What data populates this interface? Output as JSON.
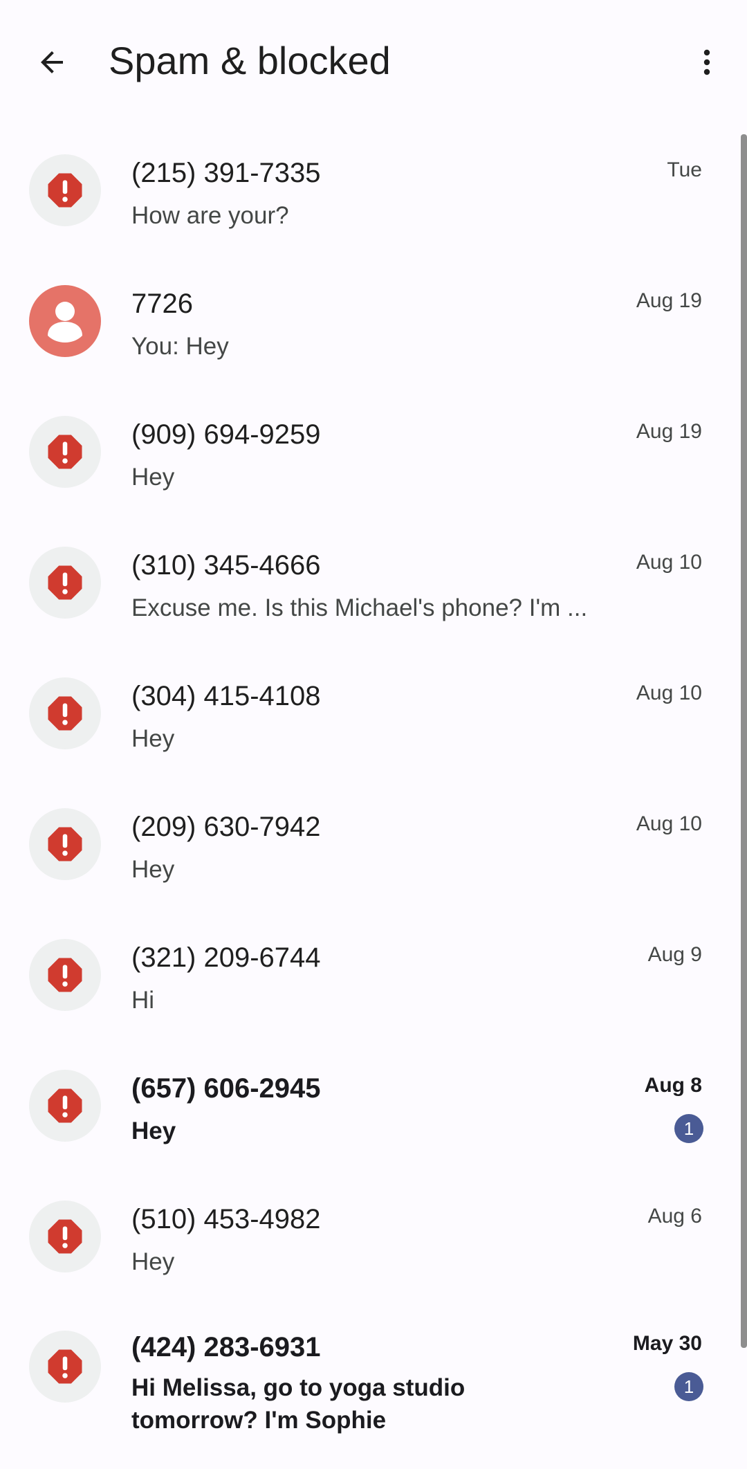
{
  "header": {
    "title": "Spam & blocked",
    "back_icon": "arrow-back-icon",
    "more_icon": "more-vert-icon"
  },
  "colors": {
    "background": "#FDFBFF",
    "spam_icon": "#D03B2F",
    "contact_avatar": "#E57368",
    "unread_badge": "#4A5B95"
  },
  "conversations": [
    {
      "name": "(215) 391-7335",
      "snippet": "How are your?",
      "date": "Tue",
      "unread": false,
      "avatar": "spam-warning-icon"
    },
    {
      "name": "7726",
      "snippet": "You: Hey",
      "date": "Aug 19",
      "unread": false,
      "avatar": "person-icon"
    },
    {
      "name": "(909) 694-9259",
      "snippet": "Hey",
      "date": "Aug 19",
      "unread": false,
      "avatar": "spam-warning-icon"
    },
    {
      "name": "(310) 345-4666",
      "snippet": "Excuse me. Is this Michael's phone? I'm ...",
      "date": "Aug 10",
      "unread": false,
      "avatar": "spam-warning-icon"
    },
    {
      "name": "(304) 415-4108",
      "snippet": "Hey",
      "date": "Aug 10",
      "unread": false,
      "avatar": "spam-warning-icon"
    },
    {
      "name": "(209) 630-7942",
      "snippet": "Hey",
      "date": "Aug 10",
      "unread": false,
      "avatar": "spam-warning-icon"
    },
    {
      "name": "(321) 209-6744",
      "snippet": "Hi",
      "date": "Aug 9",
      "unread": false,
      "avatar": "spam-warning-icon"
    },
    {
      "name": "(657) 606-2945",
      "snippet": "Hey",
      "date": "Aug 8",
      "unread": true,
      "badge": "1",
      "avatar": "spam-warning-icon"
    },
    {
      "name": "(510) 453-4982",
      "snippet": "Hey",
      "date": "Aug 6",
      "unread": false,
      "avatar": "spam-warning-icon"
    },
    {
      "name": "(424) 283-6931",
      "snippet": "Hi Melissa, go to yoga studio tomorrow? I'm Sophie",
      "date": "May 30",
      "unread": true,
      "badge": "1",
      "avatar": "spam-warning-icon"
    }
  ]
}
